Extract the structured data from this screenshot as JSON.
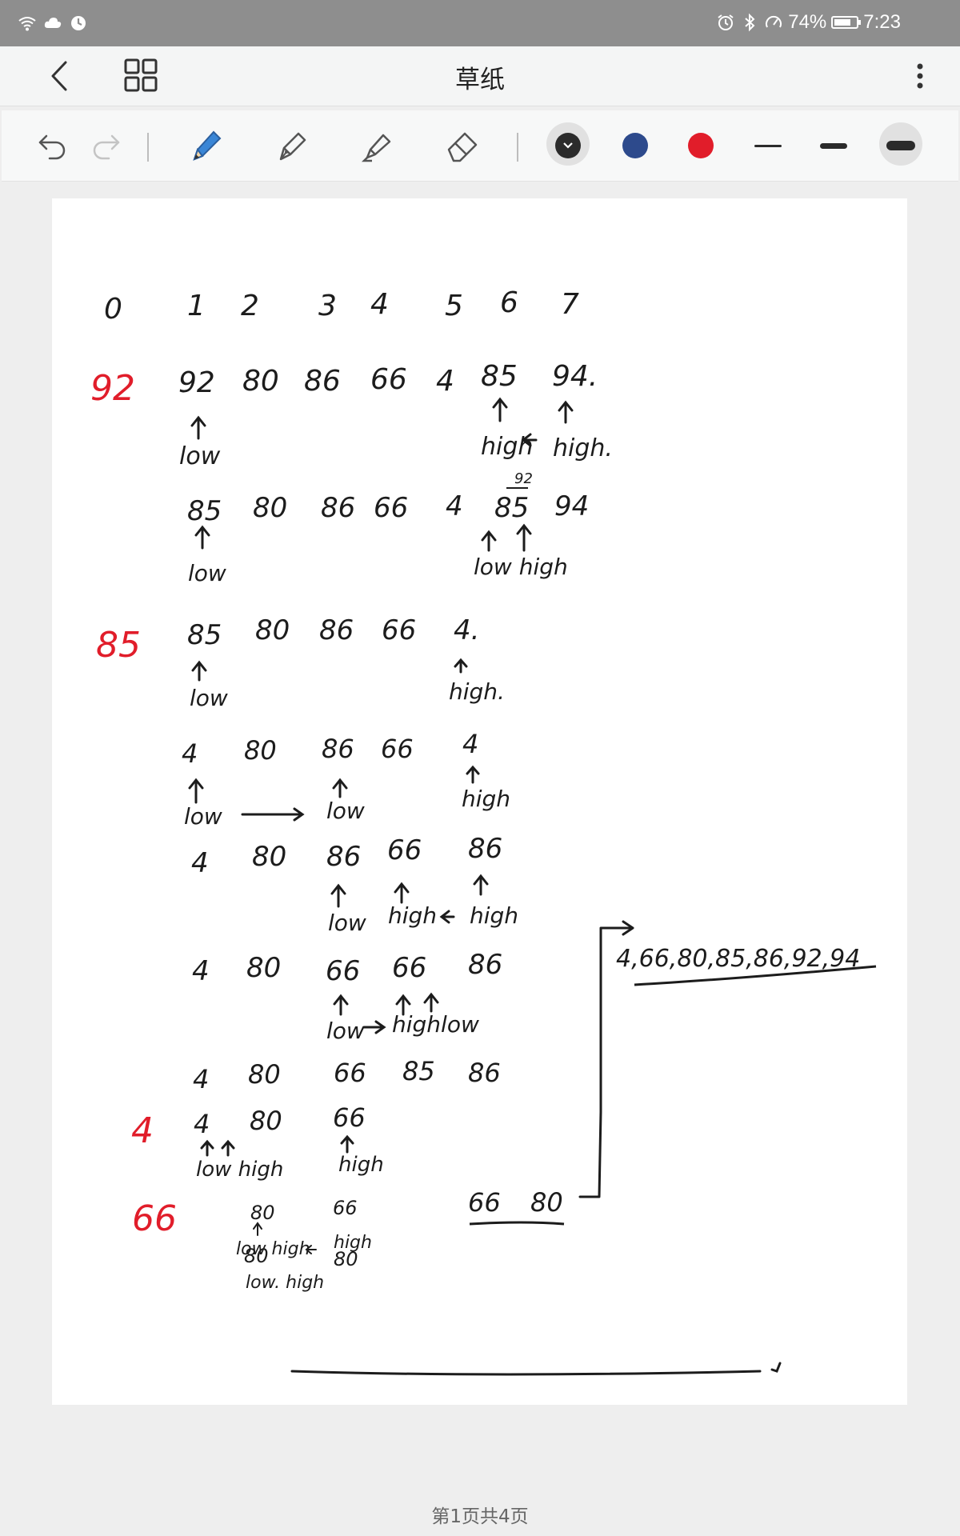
{
  "status_bar": {
    "battery": "74%",
    "time": "7:23",
    "battery_level": 0.74
  },
  "header": {
    "title": "草纸"
  },
  "toolbar": {
    "tools": [
      "undo-icon",
      "redo-icon",
      "pencil-icon",
      "fountain-pen-icon",
      "highlighter-icon",
      "eraser-icon"
    ],
    "colors": [
      "#2b2b2b",
      "#2d4a8c",
      "#e11d2a"
    ],
    "selected_color": "#2b2b2b",
    "stroke_widths": [
      "thin",
      "medium",
      "thick"
    ],
    "selected_width": "thick"
  },
  "notes": {
    "index_row": [
      "0",
      "1",
      "2",
      "3",
      "4",
      "5",
      "6",
      "7"
    ],
    "pivot_labels": [
      "92",
      "85",
      "4",
      "66"
    ],
    "pass1_row": [
      "92",
      "80",
      "86",
      "66",
      "4",
      "85",
      "94."
    ],
    "pass2_row": [
      "85",
      "80",
      "86",
      "66",
      "4",
      "85",
      "94"
    ],
    "pass2_small": "92",
    "pass3_row": [
      "85",
      "80",
      "86",
      "66",
      "4."
    ],
    "pass4_row": [
      "4",
      "80",
      "86",
      "66",
      "4"
    ],
    "pass5_row": [
      "4",
      "80",
      "86",
      "66",
      "86"
    ],
    "pass6_row": [
      "4",
      "80",
      "66",
      "66",
      "86"
    ],
    "pass7_row": [
      "4",
      "80",
      "66",
      "85",
      "86"
    ],
    "pass8_row": [
      "4",
      "80",
      "66"
    ],
    "pass9_top": [
      "80",
      "66"
    ],
    "pass9_bottom": [
      "80",
      "80"
    ],
    "right_pair": [
      "66",
      "80"
    ],
    "result": "4,66,80,85,86,92,94",
    "labels": {
      "low": "low",
      "high": "high",
      "high_dot": "high.",
      "lowhigh": "low high",
      "hightlow": "highlow",
      "lowhigh2": "low high",
      "Tlow_high": "low. high"
    }
  },
  "page_indicator": "第1页共4页"
}
